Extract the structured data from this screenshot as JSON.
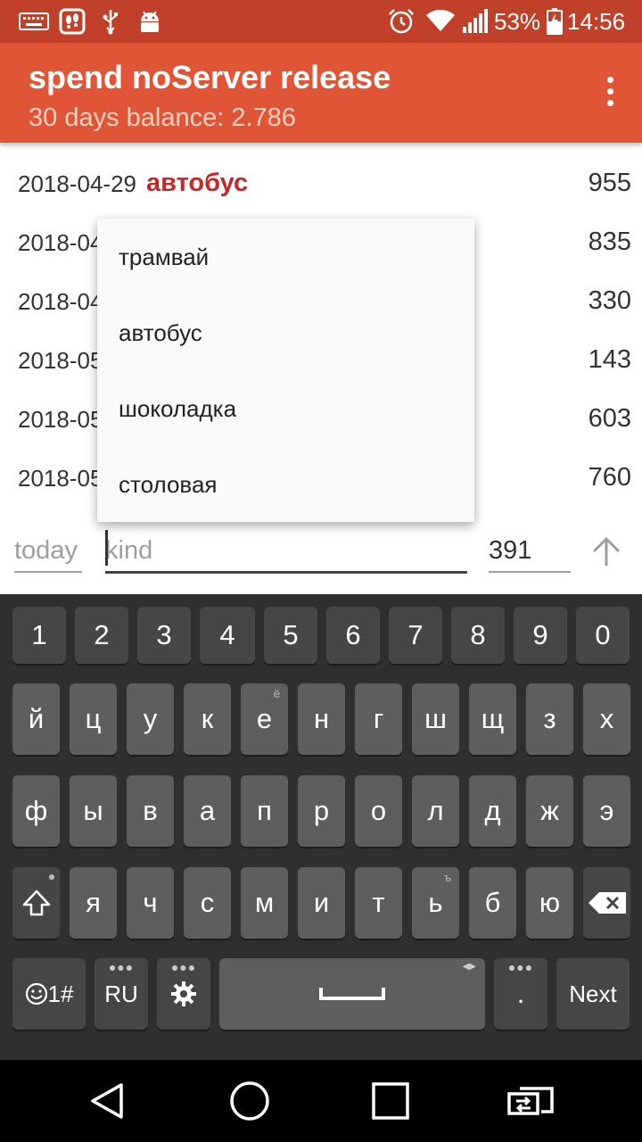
{
  "status_bar": {
    "battery_percent": "53%",
    "time": "14:56",
    "icons": [
      "keyboard-icon",
      "footprint-app-icon",
      "usb-icon",
      "android-debug-icon",
      "alarm-icon",
      "wifi-icon",
      "signal-icon",
      "battery-charging-icon"
    ]
  },
  "app_bar": {
    "title": "spend noServer release",
    "subtitle": "30 days balance: 2.786",
    "background": "#e05535"
  },
  "transactions": [
    {
      "date": "2018-04-29",
      "kind": "автобус",
      "amount": "955"
    },
    {
      "date": "2018-04",
      "kind": "",
      "amount": "835"
    },
    {
      "date": "2018-04",
      "kind": "",
      "amount": "330"
    },
    {
      "date": "2018-05",
      "kind": "",
      "amount": "143"
    },
    {
      "date": "2018-05",
      "kind": "",
      "amount": "603"
    },
    {
      "date": "2018-05",
      "kind": "",
      "amount": "760"
    }
  ],
  "dropdown": {
    "items": [
      "трамвай",
      "автобус",
      "шоколадка",
      "столовая"
    ]
  },
  "input_row": {
    "date_value": "today",
    "kind_placeholder": "kind",
    "amount_value": "391"
  },
  "keyboard": {
    "number_row": [
      "1",
      "2",
      "3",
      "4",
      "5",
      "6",
      "7",
      "8",
      "9",
      "0"
    ],
    "row1": [
      "й",
      "ц",
      "у",
      "к",
      "е",
      "н",
      "г",
      "ш",
      "щ",
      "з",
      "х"
    ],
    "row1_hint_e": "ё",
    "row2": [
      "ф",
      "ы",
      "в",
      "а",
      "п",
      "р",
      "о",
      "л",
      "д",
      "ж",
      "э"
    ],
    "row3": [
      "я",
      "ч",
      "с",
      "м",
      "и",
      "т",
      "ь",
      "б",
      "ю"
    ],
    "row3_hint_soft": "ъ",
    "symbols_label": "1#",
    "language_label": "RU",
    "period_label": ".",
    "next_label": "Next"
  },
  "nav_bar": {
    "buttons": [
      "back-icon",
      "home-icon",
      "recents-icon",
      "screen-mirror-icon"
    ]
  }
}
